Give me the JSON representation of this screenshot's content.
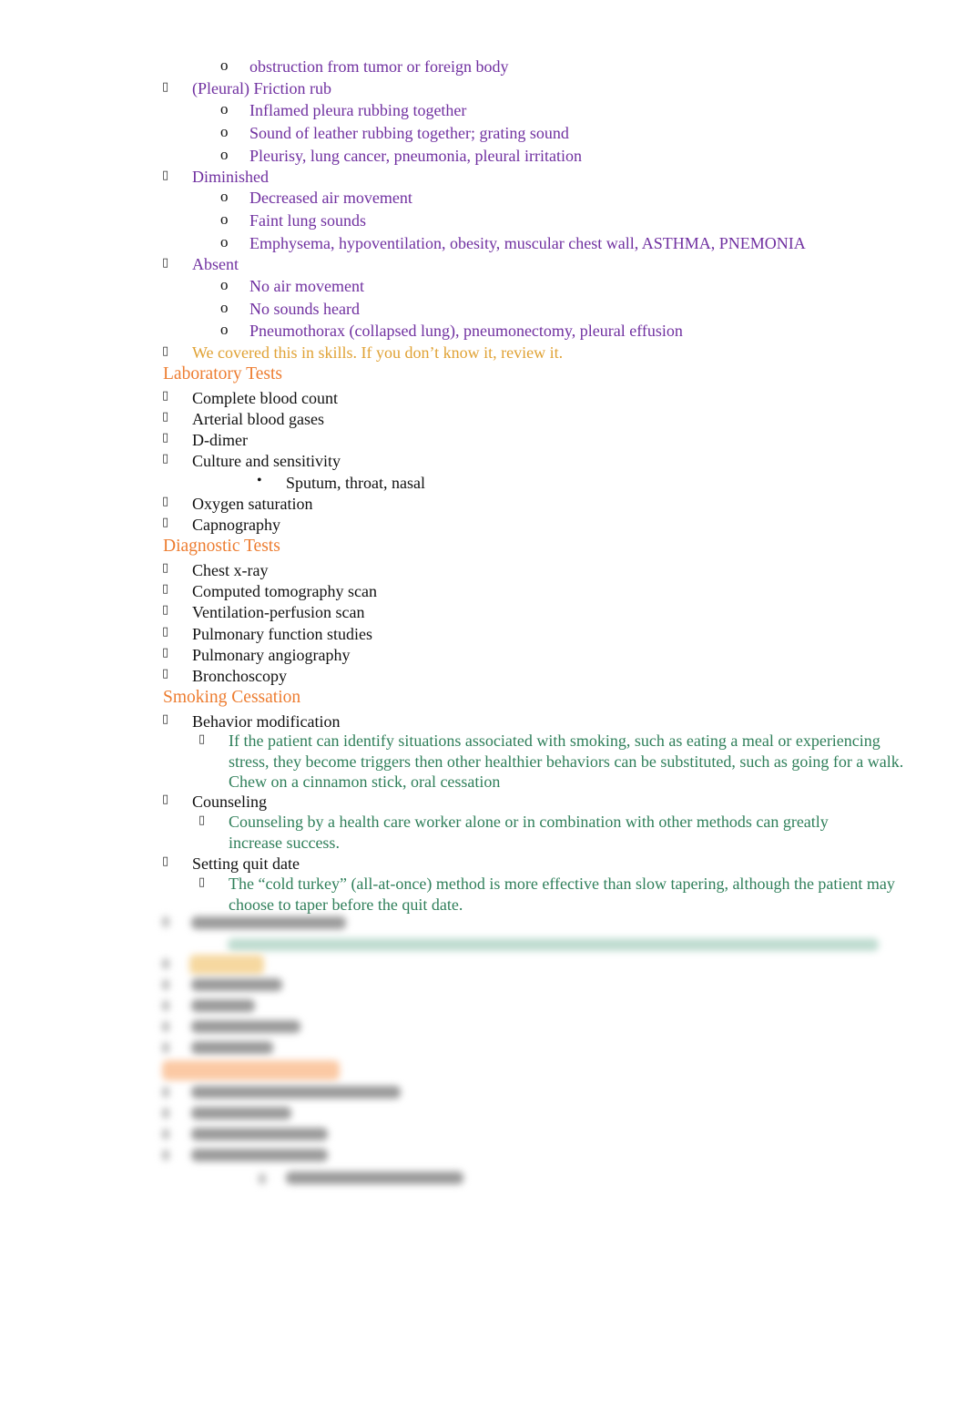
{
  "breath_sounds": {
    "lead_item": "obstruction from tumor or foreign body",
    "groups": [
      {
        "label": "(Pleural) Friction rub",
        "items": [
          "Inflamed pleura rubbing together",
          "Sound of leather rubbing together; grating sound",
          "Pleurisy, lung cancer, pneumonia, pleural irritation"
        ]
      },
      {
        "label": "Diminished",
        "items": [
          "Decreased air movement",
          "Faint lung sounds",
          "Emphysema, hypoventilation, obesity, muscular chest wall, ASTHMA, PNEMONIA"
        ]
      },
      {
        "label": "Absent",
        "items": [
          "No air movement",
          "No sounds heard",
          "Pneumothorax (collapsed lung), pneumonectomy,   pleural effusion"
        ]
      }
    ],
    "note": "We covered this in skills. If you don’t know it, review it."
  },
  "laboratory_tests": {
    "heading": "Laboratory Tests",
    "items": [
      "Complete blood count",
      "Arterial blood gases",
      "D-dimer",
      "Culture and sensitivity"
    ],
    "culture_sub": "Sputum, throat, nasal",
    "items_after": [
      "Oxygen saturation",
      "Capnography"
    ]
  },
  "diagnostic_tests": {
    "heading": "Diagnostic Tests",
    "items": [
      "Chest x-ray",
      "Computed tomography scan",
      "Ventilation-perfusion scan",
      "Pulmonary function studies",
      "Pulmonary angiography",
      "Bronchoscopy"
    ]
  },
  "smoking_cessation": {
    "heading": "Smoking Cessation",
    "items": [
      {
        "label": "Behavior modification",
        "detail": "If the patient can identify situations associated with smoking, such as eating a meal or experiencing stress, they become triggers then other healthier behaviors can be substituted, such as going for a walk. Chew on a cinnamon stick, oral cessation"
      },
      {
        "label": "Counseling",
        "detail": "Counseling by a health care worker alone or in combination with other methods can greatly increase success."
      },
      {
        "label": "Setting quit date",
        "detail": "The “cold turkey” (all-at-once) method is more effective than slow tapering, although the patient may choose to taper before the quit date."
      }
    ]
  },
  "bullets": {
    "square": "",
    "circle": "o",
    "dot": "•"
  }
}
